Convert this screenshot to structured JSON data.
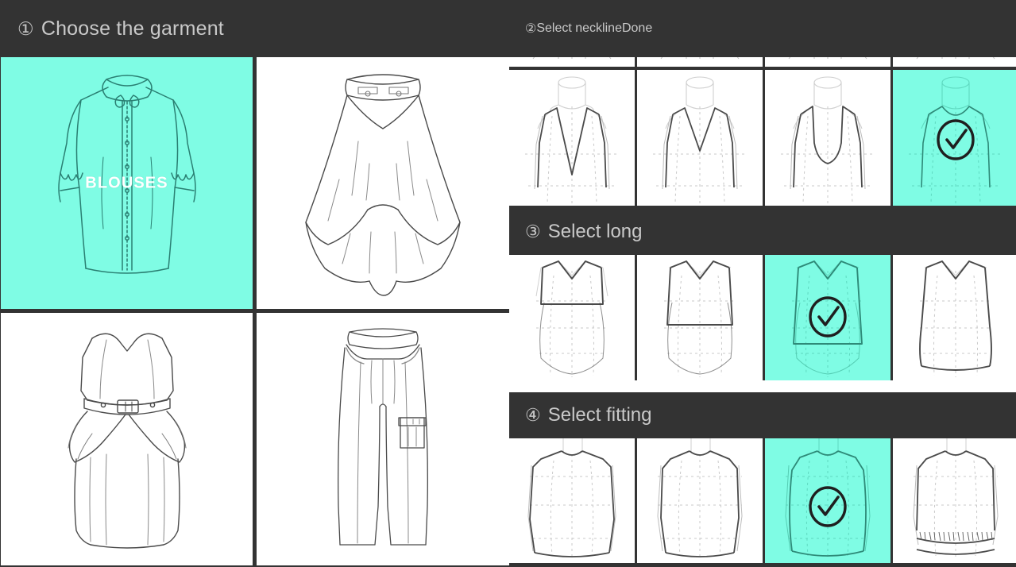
{
  "accent_color": "#7FFCE4",
  "header_bg": "#333333",
  "header_text_color": "#c9c9c9",
  "left_panel": {
    "step_num": "①",
    "title": "Choose the garment",
    "garments": [
      {
        "id": "blouses",
        "label": "BLOUSES",
        "icon": "blouse-icon",
        "selected": true
      },
      {
        "id": "skirts",
        "label": "",
        "icon": "high-low-skirt-icon",
        "selected": false
      },
      {
        "id": "dresses",
        "label": "",
        "icon": "strapless-dress-icon",
        "selected": false
      },
      {
        "id": "pants",
        "label": "",
        "icon": "cargo-pants-icon",
        "selected": false
      }
    ]
  },
  "right_panel": {
    "done_label": "Done",
    "sections": [
      {
        "id": "neckline",
        "step_num": "②",
        "title": "Select neckline",
        "options": [
          {
            "id": "neckline-1",
            "icon": "deep-v-neckline-icon",
            "selected": false
          },
          {
            "id": "neckline-2",
            "icon": "v-neckline-icon",
            "selected": false
          },
          {
            "id": "neckline-3",
            "icon": "sweetheart-neckline-icon",
            "selected": false
          },
          {
            "id": "neckline-4",
            "icon": "round-neckline-icon",
            "selected": true
          }
        ]
      },
      {
        "id": "long",
        "step_num": "③",
        "title": "Select long",
        "options": [
          {
            "id": "long-1",
            "icon": "crop-length-icon",
            "selected": false
          },
          {
            "id": "long-2",
            "icon": "short-length-icon",
            "selected": false
          },
          {
            "id": "long-3",
            "icon": "waist-length-icon",
            "selected": true
          },
          {
            "id": "long-4",
            "icon": "hip-length-icon",
            "selected": false
          }
        ]
      },
      {
        "id": "fitting",
        "step_num": "④",
        "title": "Select fitting",
        "options": [
          {
            "id": "fitting-1",
            "icon": "straight-fit-icon",
            "selected": false
          },
          {
            "id": "fitting-2",
            "icon": "semi-fit-icon",
            "selected": false
          },
          {
            "id": "fitting-3",
            "icon": "loose-fit-icon",
            "selected": true
          },
          {
            "id": "fitting-4",
            "icon": "gathered-hem-fit-icon",
            "selected": false
          }
        ]
      }
    ]
  }
}
